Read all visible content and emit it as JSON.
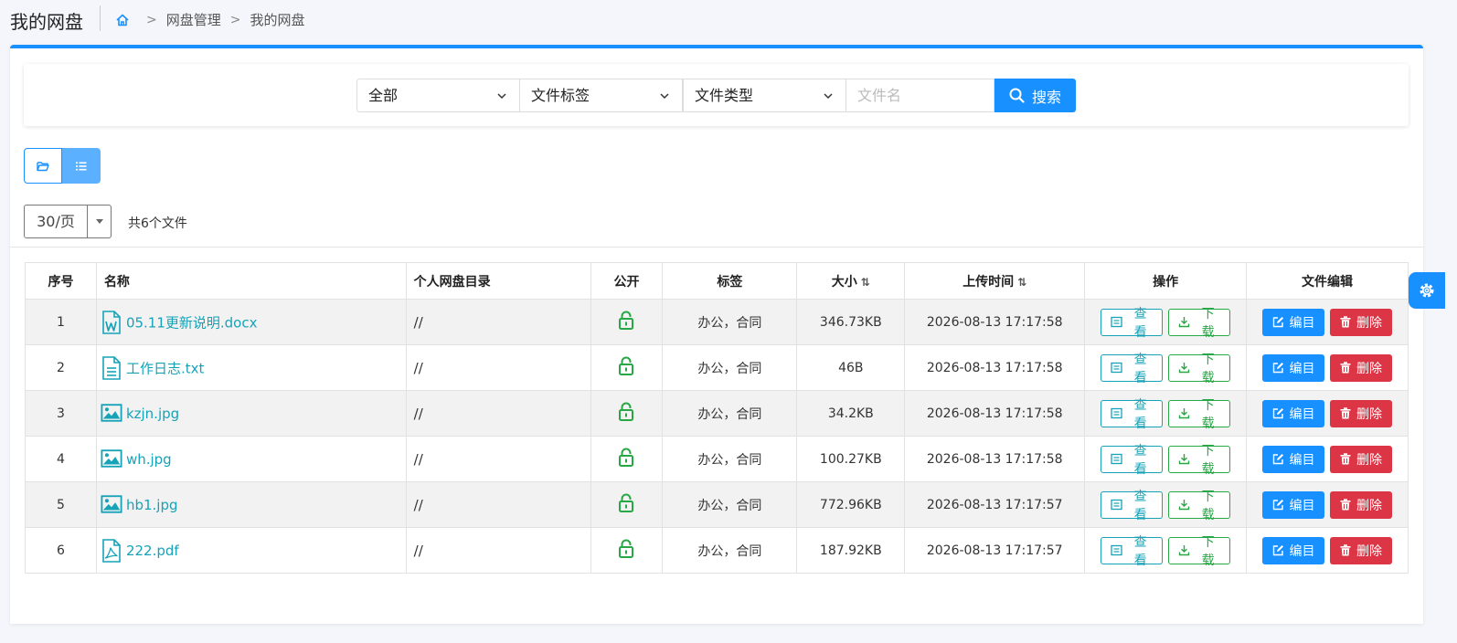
{
  "header": {
    "title": "我的网盘",
    "breadcrumb": [
      "网盘管理",
      "我的网盘"
    ]
  },
  "search": {
    "scope": "全部",
    "tag": "文件标签",
    "type": "文件类型",
    "filename_placeholder": "文件名",
    "filename_value": "",
    "button_label": "搜索"
  },
  "pagination": {
    "page_size": "30/页",
    "total": "共6个文件"
  },
  "table": {
    "headers": {
      "index": "序号",
      "name": "名称",
      "directory": "个人网盘目录",
      "public": "公开",
      "tags": "标签",
      "size": "大小",
      "uploaded": "上传时间",
      "actions": "操作",
      "edit": "文件编辑"
    },
    "actions": {
      "view": "查看",
      "download": "下载",
      "edit": "编目",
      "delete": "删除"
    },
    "rows": [
      {
        "index": "1",
        "name": "05.11更新说明.docx",
        "icon": "word-file-icon",
        "directory": "//",
        "tags": "办公，合同",
        "size": "346.73KB",
        "uploaded": "2026-08-13 17:17:58"
      },
      {
        "index": "2",
        "name": "工作日志.txt",
        "icon": "text-file-icon",
        "directory": "//",
        "tags": "办公，合同",
        "size": "46B",
        "uploaded": "2026-08-13 17:17:58"
      },
      {
        "index": "3",
        "name": "kzjn.jpg",
        "icon": "image-file-icon",
        "directory": "//",
        "tags": "办公，合同",
        "size": "34.2KB",
        "uploaded": "2026-08-13 17:17:58"
      },
      {
        "index": "4",
        "name": "wh.jpg",
        "icon": "image-file-icon",
        "directory": "//",
        "tags": "办公，合同",
        "size": "100.27KB",
        "uploaded": "2026-08-13 17:17:58"
      },
      {
        "index": "5",
        "name": "hb1.jpg",
        "icon": "image-file-icon",
        "directory": "//",
        "tags": "办公，合同",
        "size": "772.96KB",
        "uploaded": "2026-08-13 17:17:57"
      },
      {
        "index": "6",
        "name": "222.pdf",
        "icon": "pdf-file-icon",
        "directory": "//",
        "tags": "办公，合同",
        "size": "187.92KB",
        "uploaded": "2026-08-13 17:17:57"
      }
    ]
  },
  "colors": {
    "primary": "#1890ff",
    "info": "#17a2b8",
    "success": "#28a745",
    "danger": "#dc3545"
  }
}
